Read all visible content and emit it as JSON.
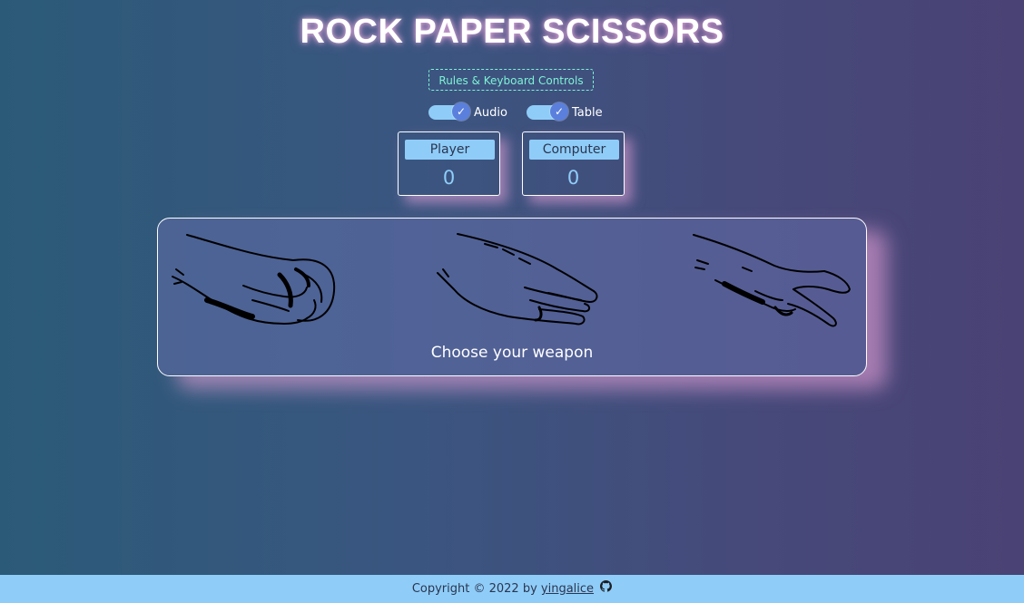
{
  "header": {
    "title": "ROCK PAPER SCISSORS",
    "rules_button_label": "Rules & Keyboard Controls"
  },
  "toggles": [
    {
      "label": "Audio",
      "checked": true,
      "icon": "check-icon"
    },
    {
      "label": "Table",
      "checked": true,
      "icon": "check-icon"
    }
  ],
  "scores": {
    "player": {
      "label": "Player",
      "value": "0"
    },
    "computer": {
      "label": "Computer",
      "value": "0"
    }
  },
  "weapons": {
    "items": [
      {
        "name": "rock",
        "icon": "rock-hand-icon"
      },
      {
        "name": "paper",
        "icon": "paper-hand-icon"
      },
      {
        "name": "scissors",
        "icon": "scissors-hand-icon"
      }
    ],
    "prompt": "Choose your weapon"
  },
  "footer": {
    "copyright": "Copyright © 2022 by",
    "author": "yingalice",
    "icon": "github-icon"
  },
  "colors": {
    "accent": "#8fcdf8",
    "rules_text": "#7ef2d6",
    "knob": "#5b7fdc",
    "glow": "#f5aae1"
  }
}
